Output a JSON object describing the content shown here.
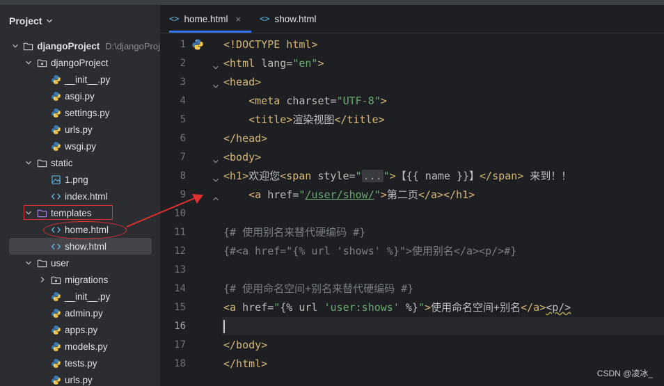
{
  "panel": {
    "title": "Project"
  },
  "tree": [
    {
      "label": "djangoProject",
      "hint": "D:\\djangoProj",
      "type": "folder",
      "level": 0,
      "expanded": true,
      "bold": true
    },
    {
      "label": "djangoProject",
      "type": "package",
      "level": 1,
      "expanded": true
    },
    {
      "label": "__init__.py",
      "type": "py",
      "level": 2
    },
    {
      "label": "asgi.py",
      "type": "py",
      "level": 2
    },
    {
      "label": "settings.py",
      "type": "py",
      "level": 2
    },
    {
      "label": "urls.py",
      "type": "py",
      "level": 2
    },
    {
      "label": "wsgi.py",
      "type": "py",
      "level": 2
    },
    {
      "label": "static",
      "type": "folder",
      "level": 1,
      "expanded": true
    },
    {
      "label": "1.png",
      "type": "img",
      "level": 2
    },
    {
      "label": "index.html",
      "type": "html",
      "level": 2
    },
    {
      "label": "templates",
      "type": "folder-purple",
      "level": 1,
      "expanded": true
    },
    {
      "label": "home.html",
      "type": "html",
      "level": 2
    },
    {
      "label": "show.html",
      "type": "html",
      "level": 2,
      "selected": true
    },
    {
      "label": "user",
      "type": "folder",
      "level": 1,
      "expanded": true
    },
    {
      "label": "migrations",
      "type": "package",
      "level": 2,
      "expanded": false
    },
    {
      "label": "__init__.py",
      "type": "py",
      "level": 2
    },
    {
      "label": "admin.py",
      "type": "py",
      "level": 2
    },
    {
      "label": "apps.py",
      "type": "py",
      "level": 2
    },
    {
      "label": "models.py",
      "type": "py",
      "level": 2
    },
    {
      "label": "tests.py",
      "type": "py",
      "level": 2
    },
    {
      "label": "urls.py",
      "type": "py",
      "level": 2
    }
  ],
  "tabs": [
    {
      "label": "home.html",
      "icon": "<>",
      "active": true,
      "close": "×"
    },
    {
      "label": "show.html",
      "icon": "<>",
      "active": false
    }
  ],
  "editor": {
    "line_numbers": [
      "1",
      "2",
      "3",
      "4",
      "5",
      "6",
      "7",
      "8",
      "9",
      "10",
      "11",
      "12",
      "13",
      "14",
      "15",
      "16",
      "17",
      "18"
    ],
    "current_line": "16",
    "lines": [
      {
        "tokens": [
          {
            "c": "tag",
            "t": "<!DOCTYPE html>"
          }
        ]
      },
      {
        "tokens": [
          {
            "c": "tag",
            "t": "<html "
          },
          {
            "c": "attr",
            "t": "lang="
          },
          {
            "c": "str",
            "t": "\"en\""
          },
          {
            "c": "tag",
            "t": ">"
          }
        ]
      },
      {
        "tokens": [
          {
            "c": "tag",
            "t": "<head>"
          }
        ]
      },
      {
        "tokens": [
          {
            "c": "txt",
            "t": "    "
          },
          {
            "c": "tag",
            "t": "<meta "
          },
          {
            "c": "attr",
            "t": "charset="
          },
          {
            "c": "str",
            "t": "\"UTF-8\""
          },
          {
            "c": "tag",
            "t": ">"
          }
        ]
      },
      {
        "tokens": [
          {
            "c": "txt",
            "t": "    "
          },
          {
            "c": "tag",
            "t": "<title>"
          },
          {
            "c": "txt",
            "t": "渲染视图"
          },
          {
            "c": "tag",
            "t": "</title>"
          }
        ]
      },
      {
        "tokens": [
          {
            "c": "tag",
            "t": "</head>"
          }
        ]
      },
      {
        "tokens": [
          {
            "c": "tag",
            "t": "<body>"
          }
        ]
      },
      {
        "tokens": [
          {
            "c": "tag",
            "t": "<h1>"
          },
          {
            "c": "txt",
            "t": "欢迎您"
          },
          {
            "c": "tag",
            "t": "<span "
          },
          {
            "c": "attr",
            "t": "style="
          },
          {
            "c": "str",
            "t": "\""
          },
          {
            "c": "fold-box",
            "t": "..."
          },
          {
            "c": "str",
            "t": "\""
          },
          {
            "c": "tag",
            "t": ">"
          },
          {
            "c": "txt",
            "t": "【{{ name }}】"
          },
          {
            "c": "tag",
            "t": "</span>"
          },
          {
            "c": "txt",
            "t": " 来到！！"
          }
        ]
      },
      {
        "tokens": [
          {
            "c": "txt",
            "t": "    "
          },
          {
            "c": "tag",
            "t": "<a "
          },
          {
            "c": "attr",
            "t": "href="
          },
          {
            "c": "str",
            "t": "\""
          },
          {
            "c": "link",
            "t": "/user/show/"
          },
          {
            "c": "str",
            "t": "\""
          },
          {
            "c": "tag",
            "t": ">"
          },
          {
            "c": "txt",
            "t": "第二页"
          },
          {
            "c": "tag",
            "t": "</a></h1>"
          }
        ]
      },
      {
        "tokens": []
      },
      {
        "tokens": [
          {
            "c": "cmt",
            "t": "{# 使用别名来替代硬编码 #}"
          }
        ]
      },
      {
        "tokens": [
          {
            "c": "cmt",
            "t": "{#<a href=\"{% url 'shows' %}\">使用别名</a><p/>#}"
          }
        ]
      },
      {
        "tokens": []
      },
      {
        "tokens": [
          {
            "c": "cmt",
            "t": "{# 使用命名空间+别名来替代硬编码 #}"
          }
        ]
      },
      {
        "tokens": [
          {
            "c": "tag",
            "t": "<a "
          },
          {
            "c": "attr",
            "t": "href="
          },
          {
            "c": "str",
            "t": "\""
          },
          {
            "c": "txt",
            "t": "{% "
          },
          {
            "c": "attr",
            "t": "url "
          },
          {
            "c": "str",
            "t": "'user:shows'"
          },
          {
            "c": "txt",
            "t": " %}"
          },
          {
            "c": "str",
            "t": "\""
          },
          {
            "c": "tag",
            "t": ">"
          },
          {
            "c": "txt",
            "t": "使用命名空间+别名"
          },
          {
            "c": "tag",
            "t": "</a>"
          },
          {
            "c": "squig",
            "t": "<p/>"
          }
        ]
      },
      {
        "tokens": [
          {
            "c": "caret",
            "t": ""
          }
        ]
      },
      {
        "tokens": [
          {
            "c": "tag",
            "t": "</body>"
          }
        ]
      },
      {
        "tokens": [
          {
            "c": "tag",
            "t": "</html>"
          }
        ]
      }
    ]
  },
  "watermark": "CSDN @凌冰_",
  "colors": {
    "accent": "#3574f0",
    "annotation": "#e03030"
  }
}
